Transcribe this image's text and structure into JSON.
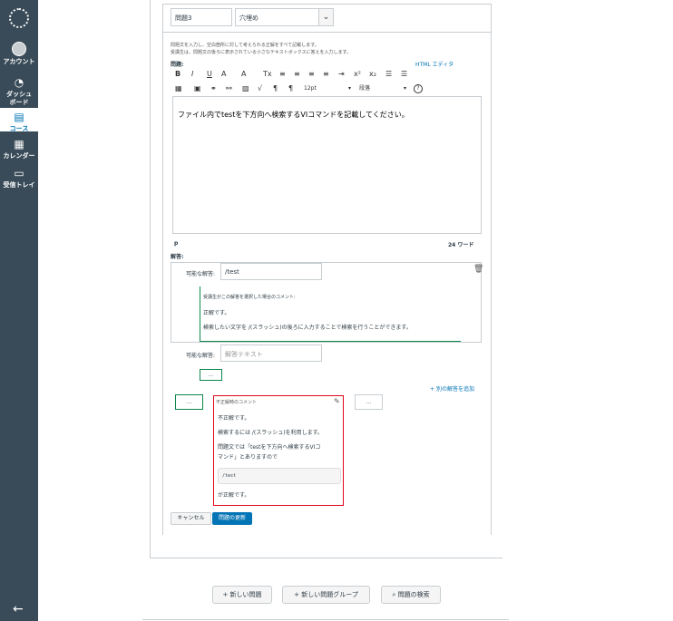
{
  "nav": {
    "items": [
      {
        "label": "アカウント",
        "icon": "user-icon"
      },
      {
        "label": "ダッシュ",
        "label2": "ボード",
        "icon": "dashboard-icon"
      },
      {
        "label": "コース",
        "icon": "book-icon"
      },
      {
        "label": "カレンダー",
        "icon": "calendar-icon"
      },
      {
        "label": "受信トレイ",
        "icon": "inbox-icon"
      }
    ],
    "collapse_icon": "←"
  },
  "question": {
    "name": "問題3",
    "type": "穴埋め",
    "help_line1": "問題文を入力し、空白箇所に対して考えられる正解をすべて記載します。",
    "help_line2": "受講生は、問題文の後ろに表示されている小さなテキストボックスに答えを入力します。",
    "question_label": "問題:",
    "html_editor_link": "HTML エディタ",
    "toolbar": {
      "bold": "B",
      "italic": "I",
      "underline": "U",
      "font_color": "A",
      "bg_color": "A",
      "clear": "Tx",
      "superscript": "x²",
      "subscript": "x₂",
      "font_size": "12pt",
      "paragraph": "段落"
    },
    "body_text": "ファイル内でtestを下方向へ検索するVIコマンドを記載してください。",
    "status_path": "p",
    "word_count": "24 ワード",
    "answers_label": "解答:"
  },
  "answers": {
    "answer1_label": "可能な解答:",
    "answer1_value": "/test",
    "comment_header": "受講生がこの解答を選択した場合のコメント:",
    "comment_line1": "正解です。",
    "comment_line2": "検索したい文字を /(スラッシュ)の後ろに入力することで検索を行うことができます。",
    "answer2_label": "可能な解答:",
    "answer2_placeholder": "解答テキスト",
    "green_btn": "...",
    "add_answer": "別の解答を追加",
    "bubble_left": "...",
    "bubble_right": "..."
  },
  "wrong_comment": {
    "header": "不正解時のコメント",
    "line1": "不正解です。",
    "line2": "検索するには /(スラッシュ)を利用します。",
    "line3": "問題文では「testを下方向へ検索するVIコ",
    "line4": "マンド」とありますので",
    "code": "/test",
    "line5": "が正解です。"
  },
  "buttons": {
    "cancel": "キャンセル",
    "update": "問題の更新"
  },
  "bottom": {
    "new_question": "新しい問題",
    "new_group": "新しい問題グループ",
    "search": "問題の検索"
  }
}
